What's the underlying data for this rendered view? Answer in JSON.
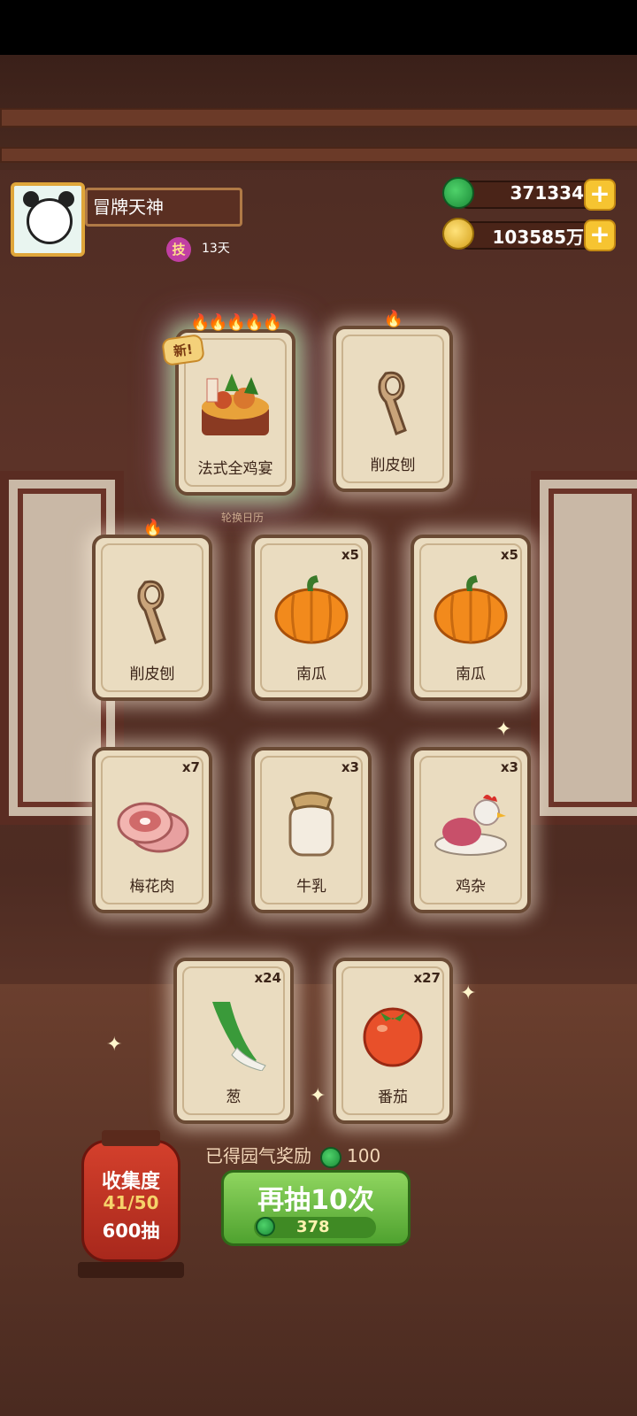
{
  "player": {
    "name": "冒牌天神",
    "skill_badge": "技",
    "days": "13天"
  },
  "currency": {
    "jade": "371334",
    "coins": "103585万",
    "add_symbol": "+"
  },
  "calendar_label": "轮换日历",
  "cards": [
    {
      "label": "法式全鸡宴",
      "qty": "",
      "flames": "🔥🔥🔥🔥🔥",
      "new": "新!",
      "art": "feast-icon"
    },
    {
      "label": "削皮刨",
      "qty": "",
      "flames": "🔥",
      "new": "",
      "art": "peeler-icon"
    },
    {
      "label": "削皮刨",
      "qty": "",
      "flames": "🔥",
      "new": "",
      "art": "peeler-icon"
    },
    {
      "label": "南瓜",
      "qty": "x5",
      "flames": "",
      "new": "",
      "art": "pumpkin-icon"
    },
    {
      "label": "南瓜",
      "qty": "x5",
      "flames": "",
      "new": "",
      "art": "pumpkin-icon"
    },
    {
      "label": "梅花肉",
      "qty": "x7",
      "flames": "",
      "new": "",
      "art": "pork-icon"
    },
    {
      "label": "牛乳",
      "qty": "x3",
      "flames": "",
      "new": "",
      "art": "milk-jar-icon"
    },
    {
      "label": "鸡杂",
      "qty": "x3",
      "flames": "",
      "new": "",
      "art": "chicken-icon"
    },
    {
      "label": "葱",
      "qty": "x24",
      "flames": "",
      "new": "",
      "art": "scallion-icon"
    },
    {
      "label": "番茄",
      "qty": "x27",
      "flames": "",
      "new": "",
      "art": "tomato-icon"
    }
  ],
  "reward": {
    "label": "已得园气奖励",
    "amount": "100"
  },
  "draw_button": {
    "label": "再抽10次",
    "cost": "378"
  },
  "collection": {
    "title": "收集度",
    "progress": "41/50",
    "draws": "600抽"
  }
}
